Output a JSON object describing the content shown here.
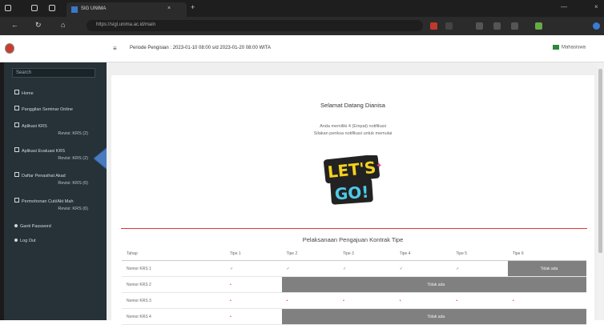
{
  "browser": {
    "tab_title": "SIG UNIMA",
    "url": "https://sigl.unima.ac.id/main",
    "new_tab_glyph": "+",
    "close_glyph": "×"
  },
  "header": {
    "menu_glyph": "≡",
    "period_info": "Periode Pengisian : 2023-01-10 08:00 s/d 2023-01-20 08:00 WITA",
    "user_name": "Mahasiswa"
  },
  "sidebar": {
    "search_placeholder": "Search",
    "items": [
      {
        "label": "Home",
        "sub": ""
      },
      {
        "label": "Panggilan Seminar Online",
        "sub": ""
      },
      {
        "label": "Aplikasi KRS",
        "sub": "Revisi: KRS (2)"
      },
      {
        "label": "Aplikasi Evaluasi KRS",
        "sub": "Revisi: KRS (2)"
      },
      {
        "label": "Daftar Penasihat Akad",
        "sub": "Revisi: KRS (6)"
      },
      {
        "label": "Permohonan Cuti/Akt Mah",
        "sub": "Revisi: KRS (6)"
      },
      {
        "label": "Ganti Password",
        "sub": ""
      },
      {
        "label": "Log Out",
        "sub": ""
      }
    ]
  },
  "main": {
    "welcome_title": "Selamat Datang Dianisa",
    "desc_line1": "Anda memiliki 4 (Empat) notifikasi",
    "desc_line2": "Silakan periksa notifikasi untuk memulai",
    "logo_text_1": "LET'S",
    "logo_text_2": "GO!",
    "section_title": "Pelaksanaan Pengajuan Kontrak Tipe",
    "table": {
      "headers": [
        "Tahap",
        "Tipe 1",
        "Tipe 2",
        "Tipe 3",
        "Tipe 4",
        "Tipe 5",
        "Tipe 6"
      ],
      "rows": [
        {
          "label": "Nomor KRS 1",
          "cells": [
            "✓",
            "✓",
            "✓",
            "✓",
            "✓"
          ],
          "gray_label": "Tidak ada",
          "gray_span": 1
        },
        {
          "label": "Nomor KRS 2",
          "cells": [
            "•"
          ],
          "gray_label": "Tidak ada",
          "gray_span": 5
        },
        {
          "label": "Nomor KRS 3",
          "cells": [
            "•",
            "•",
            "•",
            "•",
            "•",
            "•"
          ],
          "gray_label": "",
          "gray_span": 0
        },
        {
          "label": "Nomor KRS 4",
          "cells": [
            "•"
          ],
          "gray_label": "Tidak ada",
          "gray_span": 5
        }
      ]
    }
  },
  "colors": {
    "sidebar_bg": "#263238",
    "accent_red": "#e0363b",
    "arrow_blue": "#4a7bbf",
    "gray_cell": "#808080"
  }
}
